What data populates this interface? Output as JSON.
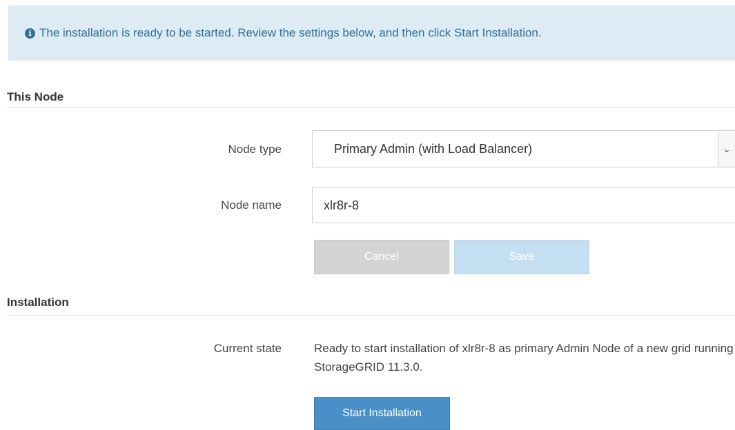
{
  "alert": {
    "icon": "info-icon",
    "text": "The installation is ready to be started. Review the settings below, and then click Start Installation."
  },
  "this_node": {
    "title": "This Node",
    "node_type_label": "Node type",
    "node_type_value": "Primary Admin (with Load Balancer)",
    "node_name_label": "Node name",
    "node_name_value": "xlr8r-8",
    "cancel_label": "Cancel",
    "save_label": "Save"
  },
  "installation": {
    "title": "Installation",
    "current_state_label": "Current state",
    "current_state_text": "Ready to start installation of xlr8r-8 as primary Admin Node of a new grid running StorageGRID 11.3.0.",
    "start_label": "Start Installation"
  },
  "colors": {
    "alert_bg": "#dcebf4",
    "alert_text": "#31708f",
    "primary_button": "#4a90c8",
    "disabled_save": "#c5dff2",
    "disabled_cancel": "#d4d4d4"
  }
}
